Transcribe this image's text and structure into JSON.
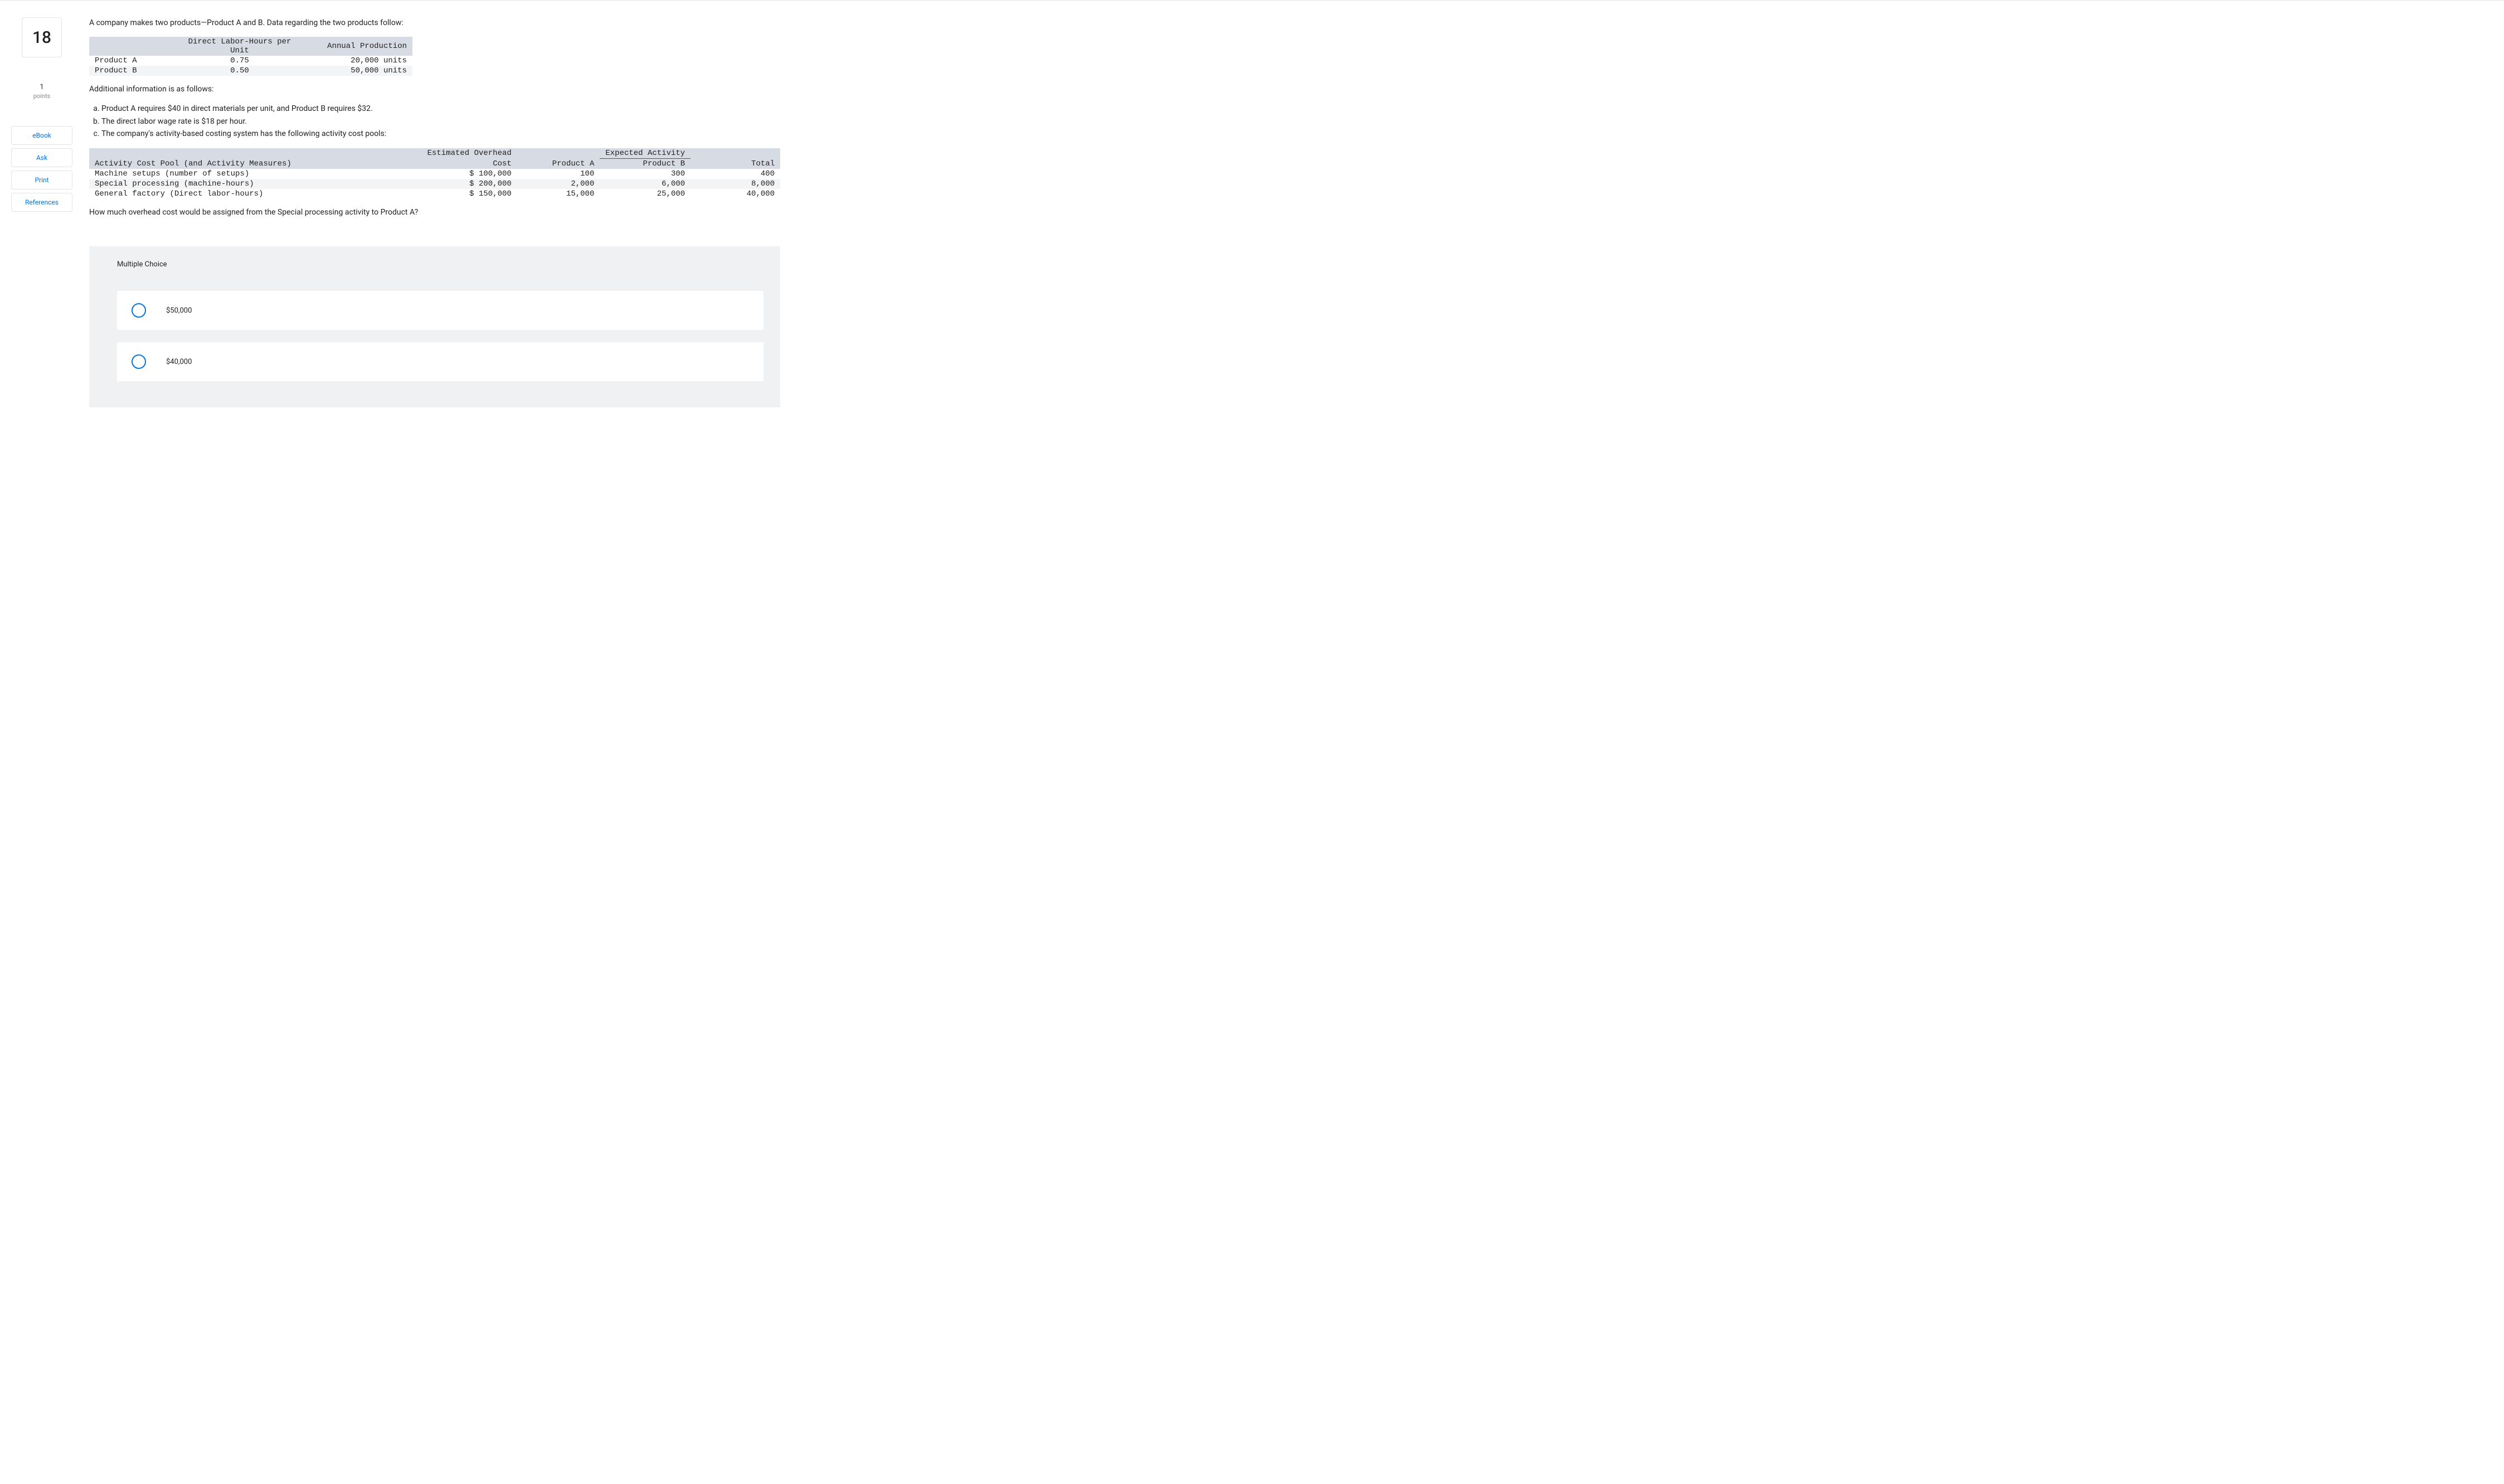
{
  "sidebar": {
    "question_number": "18",
    "points_value": "1",
    "points_label": "points",
    "buttons": {
      "ebook": "eBook",
      "ask": "Ask",
      "print": "Print",
      "references": "References"
    }
  },
  "question": {
    "intro": "A company makes two products—Product A and B. Data regarding the two products follow:",
    "table1": {
      "headers": {
        "dlh": "Direct Labor-Hours per\nUnit",
        "annual": "Annual Production"
      },
      "rows": [
        {
          "name": "Product A",
          "dlh": "0.75",
          "annual": "20,000 units"
        },
        {
          "name": "Product B",
          "dlh": "0.50",
          "annual": "50,000 units"
        }
      ]
    },
    "additional_intro": "Additional information is as follows:",
    "info_items": [
      "Product A requires $40 in direct materials per unit, and Product B requires $32.",
      "The direct labor wage rate is $18 per hour.",
      "The company's activity-based costing system has the following activity cost pools:"
    ],
    "table2": {
      "top_headers": {
        "eoc": "Estimated Overhead",
        "expected": "Expected Activity"
      },
      "headers": {
        "pool": "Activity Cost Pool (and Activity Measures)",
        "cost": "Cost",
        "pa": "Product A",
        "pb": "Product B",
        "total": "Total"
      },
      "rows": [
        {
          "pool": "Machine setups (number of setups)",
          "cost": "$ 100,000",
          "pa": "100",
          "pb": "300",
          "total": "400"
        },
        {
          "pool": "Special processing (machine-hours)",
          "cost": "$ 200,000",
          "pa": "2,000",
          "pb": "6,000",
          "total": "8,000"
        },
        {
          "pool": "General factory (Direct labor-hours)",
          "cost": "$ 150,000",
          "pa": "15,000",
          "pb": "25,000",
          "total": "40,000"
        }
      ]
    },
    "prompt": "How much overhead cost would be assigned from the Special processing activity to Product A?"
  },
  "answer": {
    "section_label": "Multiple Choice",
    "choices": [
      {
        "label": "$50,000"
      },
      {
        "label": "$40,000"
      }
    ]
  }
}
